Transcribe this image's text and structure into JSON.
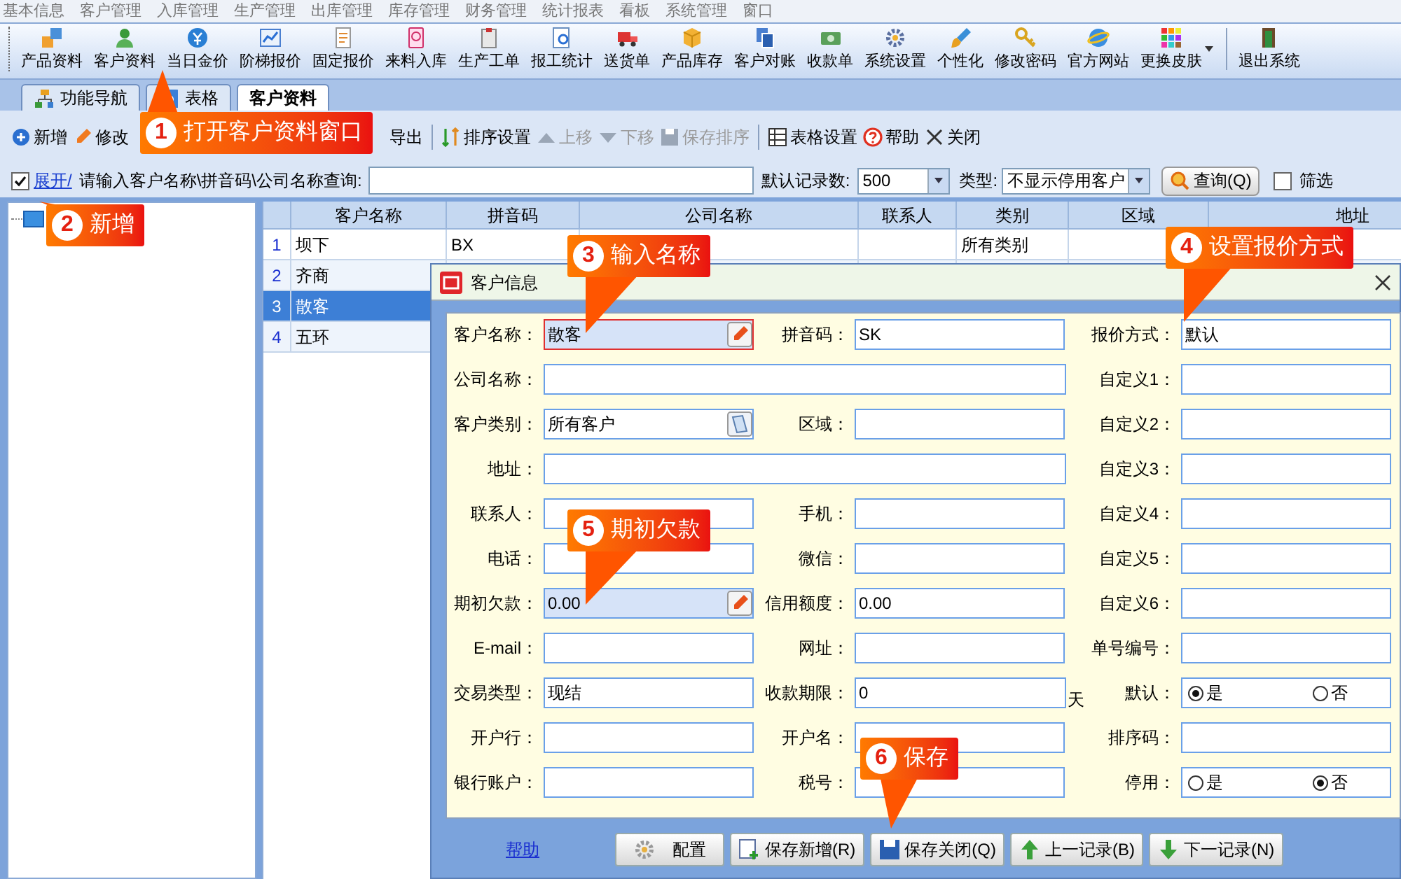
{
  "menu_bar": [
    "基本信息",
    "客户管理",
    "入库管理",
    "生产管理",
    "出库管理",
    "库存管理",
    "财务管理",
    "统计报表",
    "看板",
    "系统管理",
    "窗口"
  ],
  "toolbar": [
    {
      "label": "产品资料",
      "dropdown": false
    },
    {
      "label": "客户资料",
      "dropdown": false
    },
    {
      "label": "当日金价",
      "dropdown": false
    },
    {
      "label": "阶梯报价",
      "dropdown": false
    },
    {
      "label": "固定报价",
      "dropdown": false
    },
    {
      "label": "来料入库",
      "dropdown": false
    },
    {
      "label": "生产工单",
      "dropdown": false
    },
    {
      "label": "报工统计",
      "dropdown": false
    },
    {
      "label": "送货单",
      "dropdown": false
    },
    {
      "label": "产品库存",
      "dropdown": false
    },
    {
      "label": "客户对账",
      "dropdown": false
    },
    {
      "label": "收款单",
      "dropdown": false
    },
    {
      "label": "系统设置",
      "dropdown": false
    },
    {
      "label": "个性化",
      "dropdown": false
    },
    {
      "label": "修改密码",
      "dropdown": false
    },
    {
      "label": "官方网站",
      "dropdown": false
    },
    {
      "label": "更换皮肤",
      "dropdown": true
    },
    {
      "label": "退出系统",
      "dropdown": false
    }
  ],
  "tabs": [
    {
      "label": "功能导航",
      "selected": false
    },
    {
      "label": "表格",
      "selected": false
    },
    {
      "label": "客户资料",
      "selected": true
    }
  ],
  "action_bar": [
    [
      {
        "label": "新增",
        "disabled": false
      },
      {
        "label": "修改",
        "disabled": false
      },
      {
        "label": "导出",
        "disabled": false
      }
    ],
    [
      {
        "label": "排序设置",
        "disabled": false
      },
      {
        "label": "上移",
        "disabled": true
      },
      {
        "label": "下移",
        "disabled": true
      },
      {
        "label": "保存排序",
        "disabled": true
      }
    ],
    [
      {
        "label": "表格设置",
        "disabled": false
      },
      {
        "label": "帮助",
        "disabled": false
      },
      {
        "label": "关闭",
        "disabled": false
      }
    ]
  ],
  "search_bar": {
    "expand_checked": true,
    "expand_link": "展开/",
    "query_label": "请输入客户名称\\拼音码\\公司名称查询:",
    "record_count_label": "默认记录数:",
    "record_count": "500",
    "type_label": "类型:",
    "type_value": "不显示停用客户",
    "query_button": "查询(Q)",
    "filter_label": "筛选",
    "filter_checked": false
  },
  "table": {
    "columns": [
      "客户名称",
      "拼音码",
      "公司名称",
      "联系人",
      "类别",
      "区域",
      "地址"
    ],
    "rows": [
      {
        "number": "1",
        "name": "坝下",
        "pinyin": "BX",
        "category": "所有类别",
        "selected": false
      },
      {
        "number": "2",
        "name": "齐商",
        "selected": false
      },
      {
        "number": "3",
        "name": "散客",
        "selected": true
      },
      {
        "number": "4",
        "name": "五环",
        "selected": false
      }
    ]
  },
  "dialog": {
    "title": "客户信息",
    "form_rows": [
      [
        {
          "label": "客户名称：",
          "kind": "edit",
          "value": "散客",
          "focused": true
        },
        {
          "label": "拼音码：",
          "kind": "text",
          "value": "SK",
          "focused": false
        },
        {
          "label": "报价方式：",
          "kind": "text",
          "value": "默认",
          "focused": false
        }
      ],
      [
        {
          "label": "公司名称：",
          "kind": "wide",
          "focused": false
        },
        {
          "label": "自定义1：",
          "kind": "text",
          "focused": false
        }
      ],
      [
        {
          "label": "客户类别：",
          "kind": "lookup",
          "value": "所有客户",
          "focused": false
        },
        {
          "label": "区域：",
          "kind": "text",
          "focused": false
        },
        {
          "label": "自定义2：",
          "kind": "text",
          "focused": false
        }
      ],
      [
        {
          "label": "地址：",
          "kind": "wide",
          "focused": false
        },
        {
          "label": "自定义3：",
          "kind": "text",
          "focused": false
        }
      ],
      [
        {
          "label": "联系人：",
          "kind": "text",
          "focused": false
        },
        {
          "label": "手机：",
          "kind": "text",
          "focused": false
        },
        {
          "label": "自定义4：",
          "kind": "text",
          "focused": false
        }
      ],
      [
        {
          "label": "电话：",
          "kind": "text",
          "focused": false
        },
        {
          "label": "微信：",
          "kind": "text",
          "focused": false
        },
        {
          "label": "自定义5：",
          "kind": "text",
          "focused": false
        }
      ],
      [
        {
          "label": "期初欠款：",
          "kind": "edit",
          "value": "0.00",
          "focused": false
        },
        {
          "label": "信用额度：",
          "kind": "text",
          "value": "0.00",
          "focused": false
        },
        {
          "label": "自定义6：",
          "kind": "text",
          "focused": false
        }
      ],
      [
        {
          "label": "E-mail：",
          "kind": "text",
          "focused": false
        },
        {
          "label": "网址：",
          "kind": "text",
          "focused": false
        },
        {
          "label": "单号编号：",
          "kind": "text",
          "focused": false
        }
      ],
      [
        {
          "label": "交易类型：",
          "kind": "text",
          "value": "现结",
          "focused": false
        },
        {
          "label": "收款期限：",
          "kind": "text",
          "value": "0",
          "unit": "天",
          "focused": false
        },
        {
          "label": "默认：",
          "kind": "radio",
          "focused": false,
          "options": [
            {
              "label": "是",
              "selected": true
            },
            {
              "label": "否",
              "selected": false
            }
          ]
        }
      ],
      [
        {
          "label": "开户行：",
          "kind": "text",
          "focused": false
        },
        {
          "label": "开户名：",
          "kind": "text",
          "focused": false
        },
        {
          "label": "排序码：",
          "kind": "text",
          "focused": false
        }
      ],
      [
        {
          "label": "银行账户：",
          "kind": "text",
          "focused": false
        },
        {
          "label": "税号：",
          "kind": "text",
          "focused": false
        },
        {
          "label": "停用：",
          "kind": "radio",
          "focused": false,
          "options": [
            {
              "label": "是",
              "selected": false
            },
            {
              "label": "否",
              "selected": true
            }
          ]
        }
      ]
    ],
    "help_link": "帮助",
    "buttons": [
      "配置",
      "保存新增(R)",
      "保存关闭(Q)",
      "上一记录(B)",
      "下一记录(N)"
    ]
  },
  "callouts": [
    {
      "number": "1",
      "text": "打开客户资料窗口"
    },
    {
      "number": "2",
      "text": "新增"
    },
    {
      "number": "3",
      "text": "输入名称"
    },
    {
      "number": "4",
      "text": "设置报价方式"
    },
    {
      "number": "5",
      "text": "期初欠款"
    },
    {
      "number": "6",
      "text": "保存"
    }
  ]
}
